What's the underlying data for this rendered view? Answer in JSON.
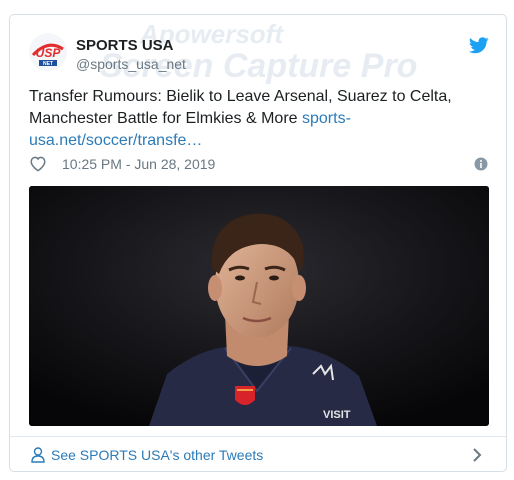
{
  "tweet": {
    "account_name": "SPORTS USA",
    "handle": "@sports_usa_net",
    "text": "Transfer Rumours: Bielik to Leave Arsenal, Suarez to Celta, Manchester Battle for Elmkies & More",
    "link_text": "sports-usa.net/soccer/transfe…",
    "timestamp": "10:25 PM - Jun 28, 2019",
    "avatar_text": "USP",
    "avatar_subtext": "NET",
    "image_texts": {
      "shirt_sponsor": "VISIT"
    }
  },
  "footer": {
    "label": "See SPORTS USA's other Tweets"
  },
  "watermark": {
    "line1": "Apowersoft",
    "line2": "Screen Capture Pro"
  },
  "colors": {
    "twitter_blue": "#1da1f2",
    "link_blue": "#2b7bb9",
    "text_dark": "#1c2022",
    "text_gray": "#697882",
    "border": "#d6dfe6",
    "avatar_red": "#e32c2c",
    "avatar_blue": "#1f4e9c"
  },
  "icons": [
    "twitter-bird-icon",
    "heart-icon",
    "info-icon",
    "user-icon",
    "chevron-right-icon"
  ]
}
